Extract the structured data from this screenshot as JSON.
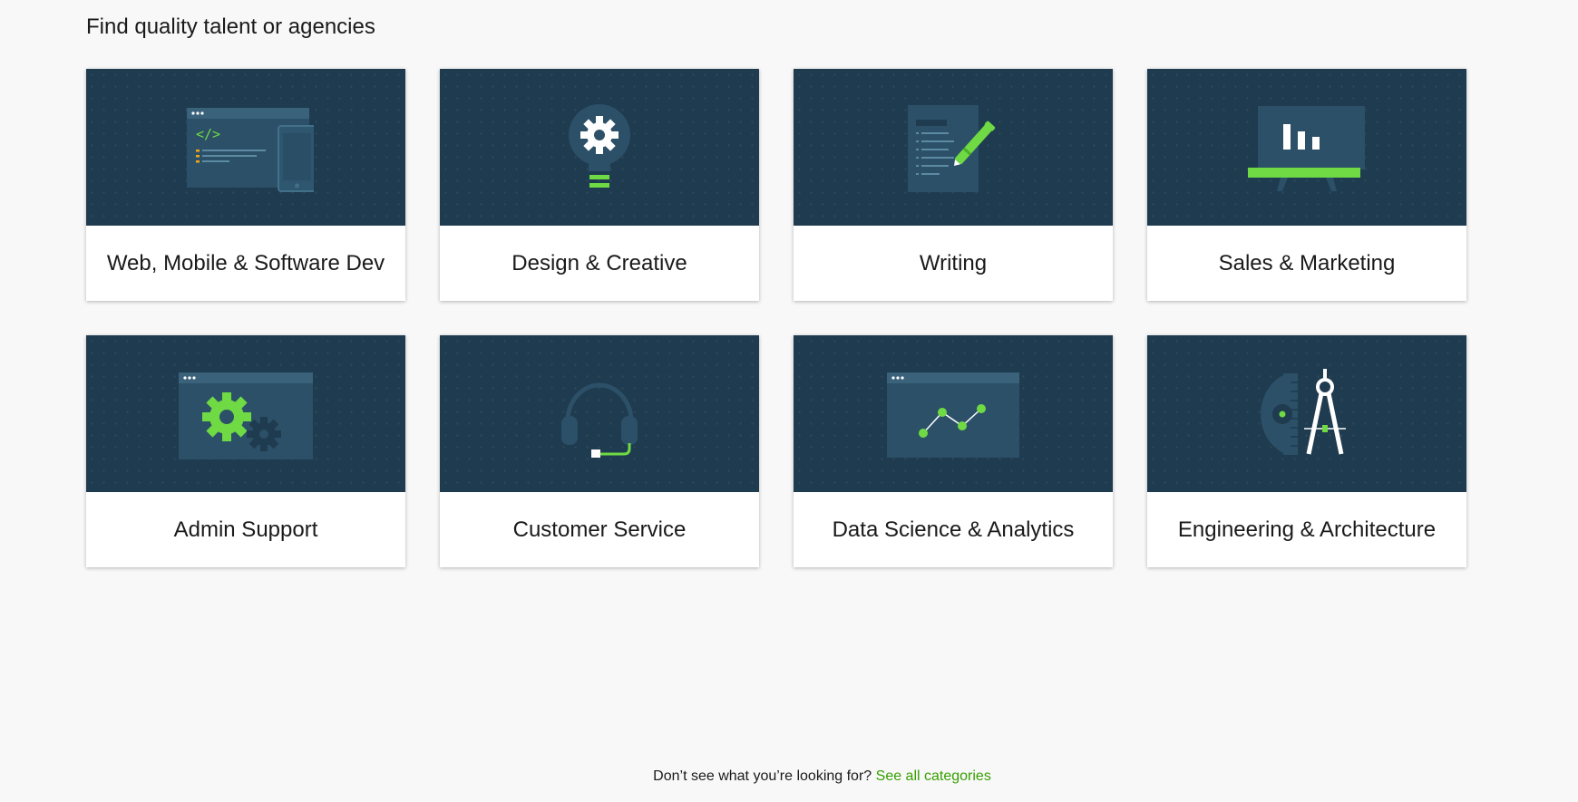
{
  "heading": "Find quality talent or agencies",
  "colors": {
    "background": "#f8f8f8",
    "card_image_bg": "#1f3b4f",
    "accent_green": "#6fda44",
    "link_green": "#37a000"
  },
  "categories": [
    {
      "label": "Web, Mobile & Software Dev",
      "icon": "web-mobile-dev-icon"
    },
    {
      "label": "Design & Creative",
      "icon": "lightbulb-gear-icon"
    },
    {
      "label": "Writing",
      "icon": "document-pen-icon"
    },
    {
      "label": "Sales & Marketing",
      "icon": "presentation-board-icon"
    },
    {
      "label": "Admin Support",
      "icon": "gears-window-icon"
    },
    {
      "label": "Customer Service",
      "icon": "headset-icon"
    },
    {
      "label": "Data Science & Analytics",
      "icon": "line-chart-window-icon"
    },
    {
      "label": "Engineering & Architecture",
      "icon": "compass-protractor-icon"
    }
  ],
  "footer": {
    "prompt": "Don’t see what you’re looking for?",
    "link_label": "See all categories"
  }
}
